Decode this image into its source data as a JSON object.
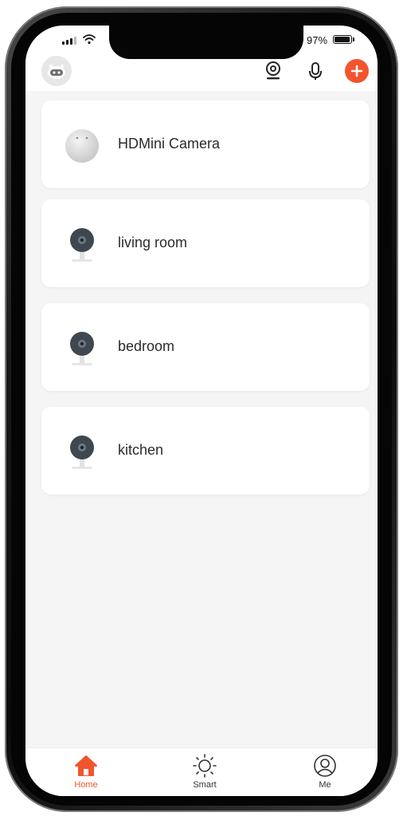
{
  "status_bar": {
    "battery_text": "97%",
    "battery_level": 0.97
  },
  "header": {
    "avatar_icon": "robot-avatar-icon",
    "camera_icon": "camera-icon",
    "mic_icon": "microphone-icon",
    "add_icon": "plus-icon"
  },
  "devices": [
    {
      "name": "HDMini Camera",
      "icon": "mini-camera-icon"
    },
    {
      "name": "living room",
      "icon": "security-camera-icon"
    },
    {
      "name": "bedroom",
      "icon": "security-camera-icon"
    },
    {
      "name": "kitchen",
      "icon": "security-camera-icon"
    }
  ],
  "tabs": [
    {
      "label": "Home",
      "icon": "home-icon",
      "active": true
    },
    {
      "label": "Smart",
      "icon": "sun-icon",
      "active": false
    },
    {
      "label": "Me",
      "icon": "user-icon",
      "active": false
    }
  ],
  "colors": {
    "accent": "#f2542d",
    "background": "#f5f5f5",
    "card": "#ffffff"
  }
}
